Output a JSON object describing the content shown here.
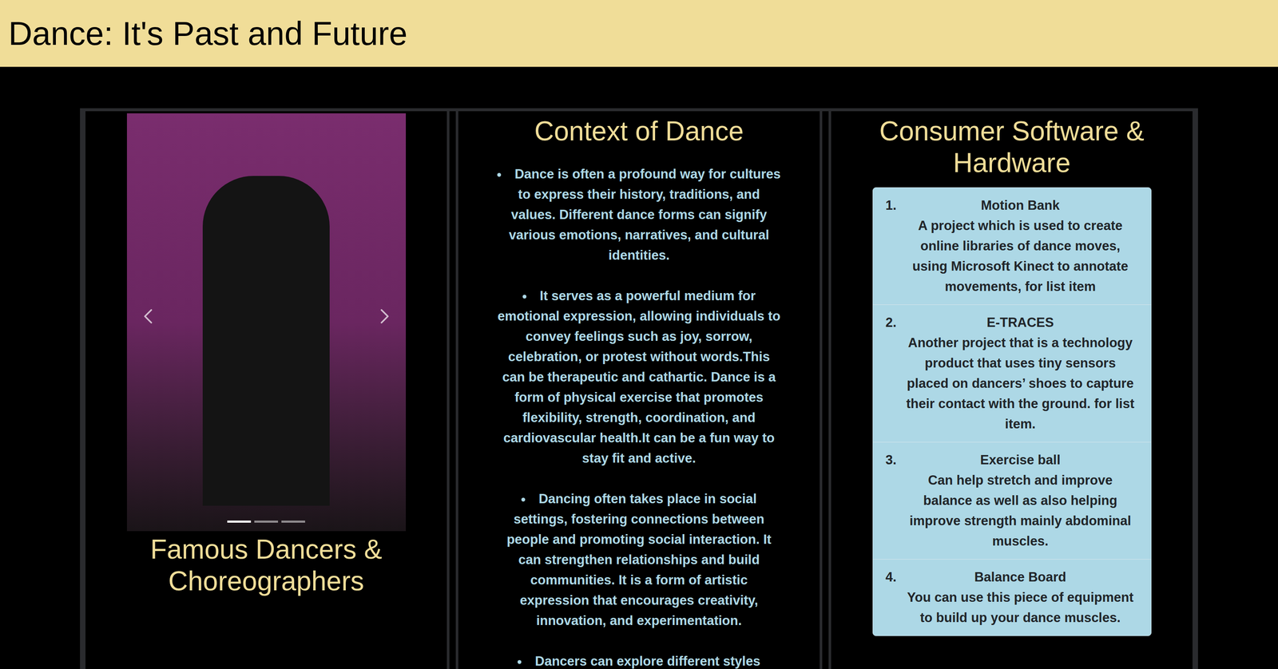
{
  "header": {
    "title": "Dance: It's Past and Future"
  },
  "carousel": {
    "caption": "Famous Dancers & Choreographers",
    "indicators": [
      {
        "selected": true
      },
      {
        "selected": false
      },
      {
        "selected": false
      }
    ]
  },
  "context": {
    "heading": "Context of Dance",
    "bullets": [
      "Dance is often a profound way for cultures to express their history, traditions, and values. Different dance forms can signify various emotions, narratives, and cultural identities.",
      "It serves as a powerful medium for emotional expression, allowing individuals to convey feelings such as joy, sorrow, celebration, or protest without words.This can be therapeutic and cathartic. Dance is a form of physical exercise that promotes flexibility, strength, coordination, and cardiovascular health.It can be a fun way to stay fit and active.",
      "Dancing often takes place in social settings, fostering connections between people and promoting social interaction. It can strengthen relationships and build communities. It is a form of artistic expression that encourages creativity, innovation, and experimentation.",
      "Dancers can explore different styles"
    ]
  },
  "products": {
    "heading": "Consumer Software & Hardware",
    "items": [
      {
        "number": "1.",
        "title": "Motion Bank",
        "description": "A project which is used to create online libraries of dance moves, using Microsoft Kinect to annotate movements, for list item"
      },
      {
        "number": "2.",
        "title": "E-TRACES",
        "description": "Another project that is a technology product that uses tiny sensors placed on dancers’ shoes to capture their contact with the ground. for list item."
      },
      {
        "number": "3.",
        "title": "Exercise ball",
        "description": "Can help stretch and improve balance as well as also helping improve strength mainly abdominal muscles."
      },
      {
        "number": "4.",
        "title": "Balance Board",
        "description": "You can use this piece of equipment to build up your dance muscles."
      }
    ]
  }
}
